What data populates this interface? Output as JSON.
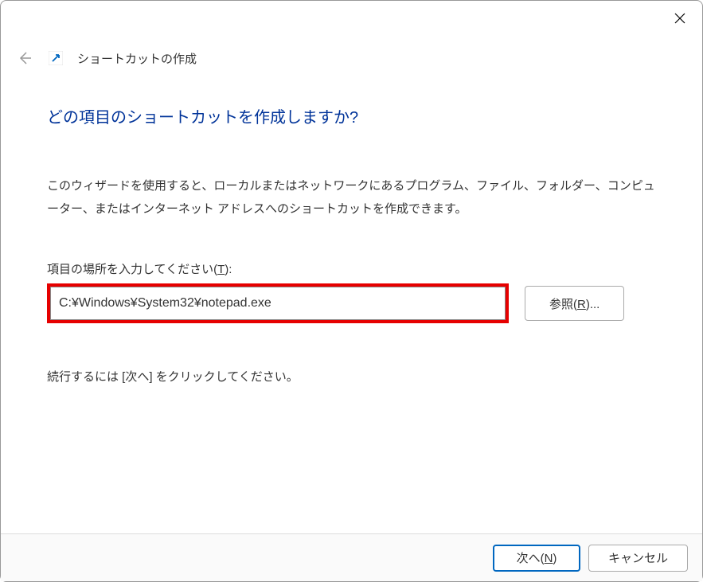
{
  "header": {
    "dialog_name": "ショートカットの作成"
  },
  "main": {
    "heading": "どの項目のショートカットを作成しますか?",
    "description": "このウィザードを使用すると、ローカルまたはネットワークにあるプログラム、ファイル、フォルダー、コンピューター、またはインターネット アドレスへのショートカットを作成できます。",
    "label_prefix": "項目の場所を入力してください(",
    "label_hotkey": "T",
    "label_suffix": "):",
    "path_value": "C:¥Windows¥System32¥notepad.exe",
    "browse_prefix": "参照(",
    "browse_hotkey": "R",
    "browse_suffix": ")...",
    "continue_text": "続行するには [次へ] をクリックしてください。"
  },
  "footer": {
    "next_prefix": "次へ(",
    "next_hotkey": "N",
    "next_suffix": ")",
    "cancel_label": "キャンセル"
  }
}
